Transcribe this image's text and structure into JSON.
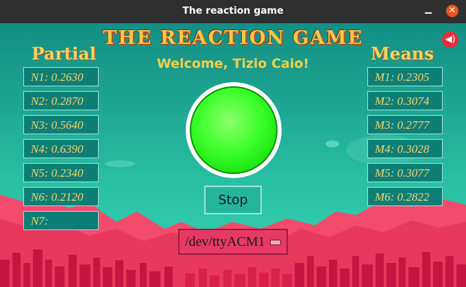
{
  "window": {
    "title": "The reaction game"
  },
  "header": {
    "game_title": "THE REACTION GAME",
    "welcome": "Welcome, Tizio Caio!"
  },
  "partial": {
    "title": "Partial",
    "items": [
      "N1: 0.2630",
      "N2: 0.2870",
      "N3: 0.5640",
      "N4: 0.6390",
      "N5: 0.2340",
      "N6: 0.2120",
      "N7:"
    ]
  },
  "means": {
    "title": "Means",
    "items": [
      "M1: 0.2305",
      "M2: 0.3074",
      "M3: 0.2777",
      "M4: 0.3028",
      "M5: 0.3077",
      "M6: 0.2822"
    ]
  },
  "controls": {
    "stop_label": "Stop",
    "port_value": "/dev/ttyACM1"
  },
  "icons": {
    "sound": "speaker-icon",
    "close": "close-icon",
    "minimize": "minimize-icon"
  },
  "colors": {
    "reaction_button": "#2cff1c",
    "accent_gold": "#f3d04a",
    "port_select": "#e63a64"
  }
}
